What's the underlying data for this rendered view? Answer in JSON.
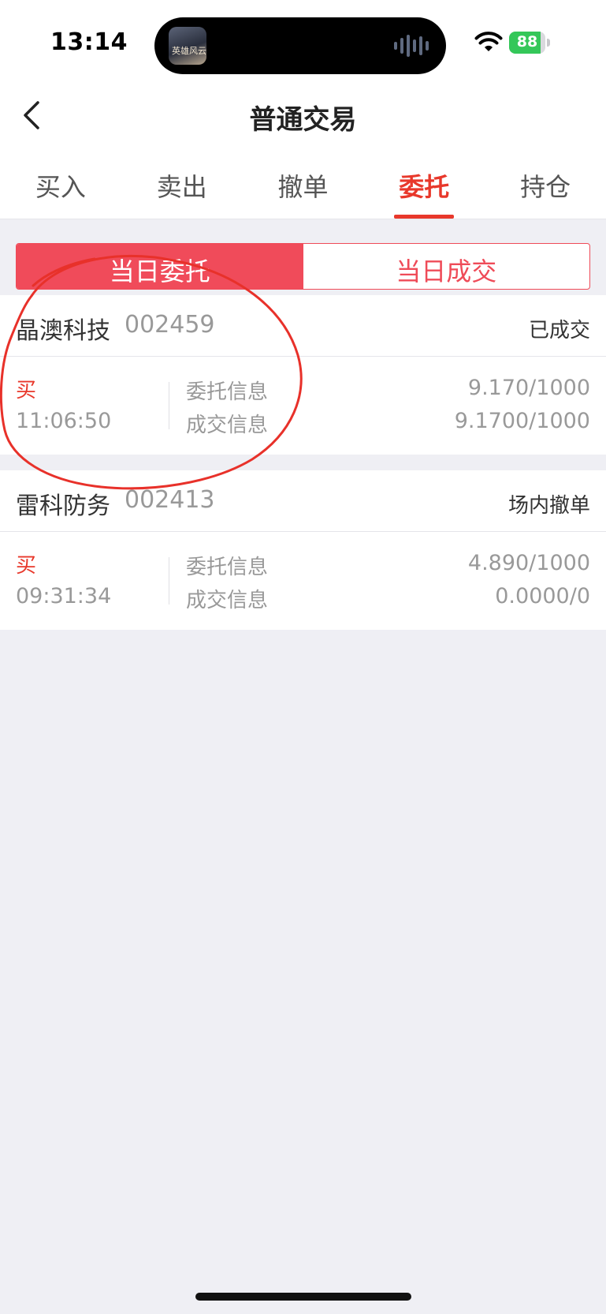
{
  "status_bar": {
    "time": "13:14",
    "battery": 88,
    "battery_text": "88",
    "island_app_mark": "英雄风云",
    "icons": [
      "wifi-icon",
      "battery-icon",
      "audio-wave-icon"
    ]
  },
  "nav": {
    "title": "普通交易",
    "back_icon": "chevron-left-icon"
  },
  "tabs": [
    {
      "label": "买入",
      "active": false
    },
    {
      "label": "卖出",
      "active": false
    },
    {
      "label": "撤单",
      "active": false
    },
    {
      "label": "委托",
      "active": true
    },
    {
      "label": "持仓",
      "active": false
    }
  ],
  "segment": {
    "options": [
      "当日委托",
      "当日成交"
    ],
    "selected": "当日委托"
  },
  "orders": [
    {
      "name": "晶澳科技",
      "code": "002459",
      "status": "已成交",
      "side": "买",
      "time": "11:06:50",
      "entrust_label": "委托信息",
      "entrust_value": "9.170/1000",
      "deal_label": "成交信息",
      "deal_value": "9.1700/1000"
    },
    {
      "name": "雷科防务",
      "code": "002413",
      "status": "场内撤单",
      "side": "买",
      "time": "09:31:34",
      "entrust_label": "委托信息",
      "entrust_value": "4.890/1000",
      "deal_label": "成交信息",
      "deal_value": "0.0000/0"
    }
  ],
  "colors": {
    "accent": "#e8382b",
    "segment_active": "#f04b5a",
    "background": "#efeff4",
    "annotation": "#e8312a"
  }
}
